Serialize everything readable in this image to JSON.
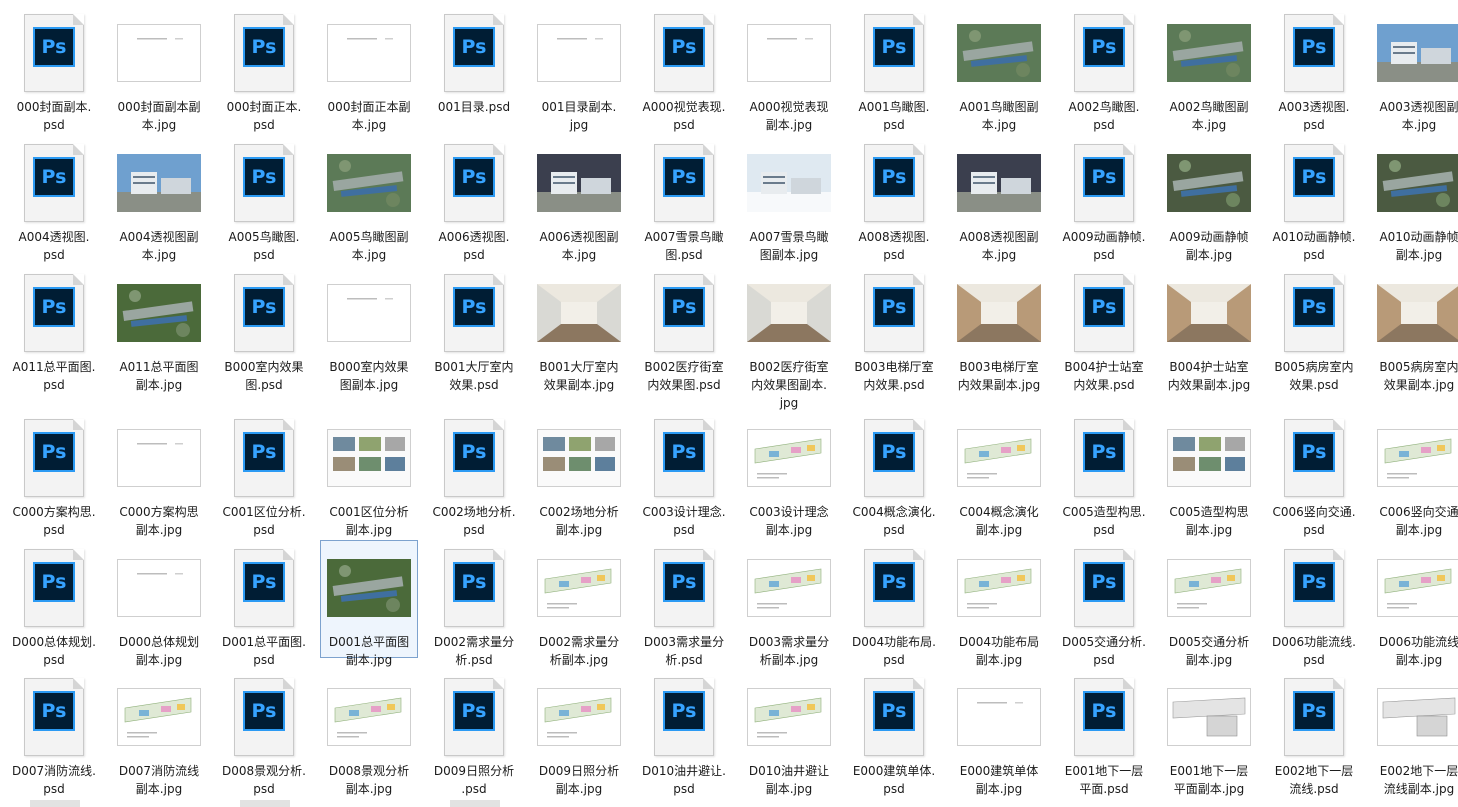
{
  "explorer": {
    "view": "large-icons",
    "selected_file": "D001总平面图副本.jpg",
    "files": [
      {
        "name": "000封面副本.psd",
        "line1": "000封面副本.",
        "line2": "psd",
        "kind": "psd"
      },
      {
        "name": "000封面副本副本.jpg",
        "line1": "000封面副本副",
        "line2": "本.jpg",
        "kind": "doc"
      },
      {
        "name": "000封面正本.psd",
        "line1": "000封面正本.",
        "line2": "psd",
        "kind": "psd"
      },
      {
        "name": "000封面正本副本.jpg",
        "line1": "000封面正本副",
        "line2": "本.jpg",
        "kind": "doc"
      },
      {
        "name": "001目录.psd",
        "line1": "001目录.psd",
        "line2": "",
        "kind": "psd"
      },
      {
        "name": "001目录副本.jpg",
        "line1": "001目录副本.",
        "line2": "jpg",
        "kind": "doc"
      },
      {
        "name": "A000视觉表现.psd",
        "line1": "A000视觉表现.",
        "line2": "psd",
        "kind": "psd"
      },
      {
        "name": "A000视觉表现副本.jpg",
        "line1": "A000视觉表现",
        "line2": "副本.jpg",
        "kind": "doc"
      },
      {
        "name": "A001鸟瞰图.psd",
        "line1": "A001鸟瞰图.",
        "line2": "psd",
        "kind": "psd"
      },
      {
        "name": "A001鸟瞰图副本.jpg",
        "line1": "A001鸟瞰图副",
        "line2": "本.jpg",
        "kind": "aerial"
      },
      {
        "name": "A002鸟瞰图.psd",
        "line1": "A002鸟瞰图.",
        "line2": "psd",
        "kind": "psd"
      },
      {
        "name": "A002鸟瞰图副本.jpg",
        "line1": "A002鸟瞰图副",
        "line2": "本.jpg",
        "kind": "aerial"
      },
      {
        "name": "A003透视图.psd",
        "line1": "A003透视图.",
        "line2": "psd",
        "kind": "psd"
      },
      {
        "name": "A003透视图副本.jpg",
        "line1": "A003透视图副",
        "line2": "本.jpg",
        "kind": "sky"
      },
      {
        "name": "A004透视图.psd",
        "line1": "A004透视图.",
        "line2": "psd",
        "kind": "psd"
      },
      {
        "name": "A004透视图副本.jpg",
        "line1": "A004透视图副",
        "line2": "本.jpg",
        "kind": "sky"
      },
      {
        "name": "A005鸟瞰图.psd",
        "line1": "A005鸟瞰图.",
        "line2": "psd",
        "kind": "psd"
      },
      {
        "name": "A005鸟瞰图副本.jpg",
        "line1": "A005鸟瞰图副",
        "line2": "本.jpg",
        "kind": "aerial"
      },
      {
        "name": "A006透视图.psd",
        "line1": "A006透视图.",
        "line2": "psd",
        "kind": "psd"
      },
      {
        "name": "A006透视图副本.jpg",
        "line1": "A006透视图副",
        "line2": "本.jpg",
        "kind": "dusk"
      },
      {
        "name": "A007雪景鸟瞰图.psd",
        "line1": "A007雪景鸟瞰",
        "line2": "图.psd",
        "kind": "psd"
      },
      {
        "name": "A007雪景鸟瞰图副本.jpg",
        "line1": "A007雪景鸟瞰",
        "line2": "图副本.jpg",
        "kind": "snow"
      },
      {
        "name": "A008透视图.psd",
        "line1": "A008透视图.",
        "line2": "psd",
        "kind": "psd"
      },
      {
        "name": "A008透视图副本.jpg",
        "line1": "A008透视图副",
        "line2": "本.jpg",
        "kind": "dusk"
      },
      {
        "name": "A009动画静帧.psd",
        "line1": "A009动画静帧.",
        "line2": "psd",
        "kind": "psd"
      },
      {
        "name": "A009动画静帧副本.jpg",
        "line1": "A009动画静帧",
        "line2": "副本.jpg",
        "kind": "collage"
      },
      {
        "name": "A010动画静帧.psd",
        "line1": "A010动画静帧.",
        "line2": "psd",
        "kind": "psd"
      },
      {
        "name": "A010动画静帧副本.jpg",
        "line1": "A010动画静帧",
        "line2": "副本.jpg",
        "kind": "collage"
      },
      {
        "name": "A011总平面图.psd",
        "line1": "A011总平面图.",
        "line2": "psd",
        "kind": "psd"
      },
      {
        "name": "A011总平面图副本.jpg",
        "line1": "A011总平面图",
        "line2": "副本.jpg",
        "kind": "plan"
      },
      {
        "name": "B000室内效果图.psd",
        "line1": "B000室内效果",
        "line2": "图.psd",
        "kind": "psd"
      },
      {
        "name": "B000室内效果图副本.jpg",
        "line1": "B000室内效果",
        "line2": "图副本.jpg",
        "kind": "doc"
      },
      {
        "name": "B001大厅室内效果.psd",
        "line1": "B001大厅室内",
        "line2": "效果.psd",
        "kind": "psd"
      },
      {
        "name": "B001大厅室内效果副本.jpg",
        "line1": "B001大厅室内",
        "line2": "效果副本.jpg",
        "kind": "interior"
      },
      {
        "name": "B002医疗街室内效果图.psd",
        "line1": "B002医疗街室",
        "line2": "内效果图.psd",
        "kind": "psd"
      },
      {
        "name": "B002医疗街室内效果图副本.jpg",
        "line1": "B002医疗街室",
        "line2": "内效果图副本.",
        "line3": "jpg",
        "kind": "interior"
      },
      {
        "name": "B003电梯厅室内效果.psd",
        "line1": "B003电梯厅室",
        "line2": "内效果.psd",
        "kind": "psd"
      },
      {
        "name": "B003电梯厅室内效果副本.jpg",
        "line1": "B003电梯厅室",
        "line2": "内效果副本.jpg",
        "kind": "warm"
      },
      {
        "name": "B004护士站室内效果.psd",
        "line1": "B004护士站室",
        "line2": "内效果.psd",
        "kind": "psd"
      },
      {
        "name": "B004护士站室内效果副本.jpg",
        "line1": "B004护士站室",
        "line2": "内效果副本.jpg",
        "kind": "warm"
      },
      {
        "name": "B005病房室内效果.psd",
        "line1": "B005病房室内",
        "line2": "效果.psd",
        "kind": "psd"
      },
      {
        "name": "B005病房室内效果副本.jpg",
        "line1": "B005病房室内",
        "line2": "效果副本.jpg",
        "kind": "warm"
      },
      {
        "name": "C000方案构思.psd",
        "line1": "C000方案构思.",
        "line2": "psd",
        "kind": "psd"
      },
      {
        "name": "C000方案构思副本.jpg",
        "line1": "C000方案构思",
        "line2": "副本.jpg",
        "kind": "doc"
      },
      {
        "name": "C001区位分析.psd",
        "line1": "C001区位分析.",
        "line2": "psd",
        "kind": "psd"
      },
      {
        "name": "C001区位分析副本.jpg",
        "line1": "C001区位分析",
        "line2": "副本.jpg",
        "kind": "board"
      },
      {
        "name": "C002场地分析.psd",
        "line1": "C002场地分析.",
        "line2": "psd",
        "kind": "psd"
      },
      {
        "name": "C002场地分析副本.jpg",
        "line1": "C002场地分析",
        "line2": "副本.jpg",
        "kind": "board"
      },
      {
        "name": "C003设计理念.psd",
        "line1": "C003设计理念.",
        "line2": "psd",
        "kind": "psd"
      },
      {
        "name": "C003设计理念副本.jpg",
        "line1": "C003设计理念",
        "line2": "副本.jpg",
        "kind": "diagram"
      },
      {
        "name": "C004概念演化.psd",
        "line1": "C004概念演化.",
        "line2": "psd",
        "kind": "psd"
      },
      {
        "name": "C004概念演化副本.jpg",
        "line1": "C004概念演化",
        "line2": "副本.jpg",
        "kind": "diagram"
      },
      {
        "name": "C005造型构思.psd",
        "line1": "C005造型构思.",
        "line2": "psd",
        "kind": "psd"
      },
      {
        "name": "C005造型构思副本.jpg",
        "line1": "C005造型构思",
        "line2": "副本.jpg",
        "kind": "board"
      },
      {
        "name": "C006竖向交通.psd",
        "line1": "C006竖向交通.",
        "line2": "psd",
        "kind": "psd"
      },
      {
        "name": "C006竖向交通副本.jpg",
        "line1": "C006竖向交通",
        "line2": "副本.jpg",
        "kind": "diagram"
      },
      {
        "name": "D000总体规划.psd",
        "line1": "D000总体规划.",
        "line2": "psd",
        "kind": "psd"
      },
      {
        "name": "D000总体规划副本.jpg",
        "line1": "D000总体规划",
        "line2": "副本.jpg",
        "kind": "doc"
      },
      {
        "name": "D001总平面图.psd",
        "line1": "D001总平面图.",
        "line2": "psd",
        "kind": "psd"
      },
      {
        "name": "D001总平面图副本.jpg",
        "line1": "D001总平面图",
        "line2": "副本.jpg",
        "kind": "plan"
      },
      {
        "name": "D002需求量分析.psd",
        "line1": "D002需求量分",
        "line2": "析.psd",
        "kind": "psd"
      },
      {
        "name": "D002需求量分析副本.jpg",
        "line1": "D002需求量分",
        "line2": "析副本.jpg",
        "kind": "diagram"
      },
      {
        "name": "D003需求量分析.psd",
        "line1": "D003需求量分",
        "line2": "析.psd",
        "kind": "psd"
      },
      {
        "name": "D003需求量分析副本.jpg",
        "line1": "D003需求量分",
        "line2": "析副本.jpg",
        "kind": "diagram"
      },
      {
        "name": "D004功能布局.psd",
        "line1": "D004功能布局.",
        "line2": "psd",
        "kind": "psd"
      },
      {
        "name": "D004功能布局副本.jpg",
        "line1": "D004功能布局",
        "line2": "副本.jpg",
        "kind": "diagram"
      },
      {
        "name": "D005交通分析.psd",
        "line1": "D005交通分析.",
        "line2": "psd",
        "kind": "psd"
      },
      {
        "name": "D005交通分析副本.jpg",
        "line1": "D005交通分析",
        "line2": "副本.jpg",
        "kind": "diagram"
      },
      {
        "name": "D006功能流线.psd",
        "line1": "D006功能流线.",
        "line2": "psd",
        "kind": "psd"
      },
      {
        "name": "D006功能流线副本.jpg",
        "line1": "D006功能流线",
        "line2": "副本.jpg",
        "kind": "diagram"
      },
      {
        "name": "D007消防流线.psd",
        "line1": "D007消防流线.",
        "line2": "psd",
        "kind": "psd"
      },
      {
        "name": "D007消防流线副本.jpg",
        "line1": "D007消防流线",
        "line2": "副本.jpg",
        "kind": "diagram"
      },
      {
        "name": "D008景观分析.psd",
        "line1": "D008景观分析.",
        "line2": "psd",
        "kind": "psd"
      },
      {
        "name": "D008景观分析副本.jpg",
        "line1": "D008景观分析",
        "line2": "副本.jpg",
        "kind": "diagram"
      },
      {
        "name": "D009日照分析.psd",
        "line1": "D009日照分析",
        "line2": ".psd",
        "kind": "psd"
      },
      {
        "name": "D009日照分析副本.jpg",
        "line1": "D009日照分析",
        "line2": "副本.jpg",
        "kind": "diagram"
      },
      {
        "name": "D010油井避让.psd",
        "line1": "D010油井避让.",
        "line2": "psd",
        "kind": "psd"
      },
      {
        "name": "D010油井避让副本.jpg",
        "line1": "D010油井避让",
        "line2": "副本.jpg",
        "kind": "diagram"
      },
      {
        "name": "E000建筑单体.psd",
        "line1": "E000建筑单体.",
        "line2": "psd",
        "kind": "psd"
      },
      {
        "name": "E000建筑单体副本.jpg",
        "line1": "E000建筑单体",
        "line2": "副本.jpg",
        "kind": "doc"
      },
      {
        "name": "E001地下一层平面.psd",
        "line1": "E001地下一层",
        "line2": "平面.psd",
        "kind": "psd"
      },
      {
        "name": "E001地下一层平面副本.jpg",
        "line1": "E001地下一层",
        "line2": "平面副本.jpg",
        "kind": "floorplan"
      },
      {
        "name": "E002地下一层流线.psd",
        "line1": "E002地下一层",
        "line2": "流线.psd",
        "kind": "psd"
      },
      {
        "name": "E002地下一层流线副本.jpg",
        "line1": "E002地下一层",
        "line2": "流线副本.jpg",
        "kind": "floorplan"
      }
    ],
    "ps_label": "Ps",
    "thumb_colors": {
      "doc": "#ffffff",
      "aerial": "#5c7a57",
      "sky": "#6fa0cf",
      "dusk": "#3b3f4e",
      "snow": "#dfe9f1",
      "collage": "#4b5a41",
      "plan": "#4b6a3a",
      "interior": "#d9d9d4",
      "warm": "#b89a78",
      "board": "#e9e9e9",
      "diagram": "#f7f7f7",
      "floorplan": "#f0f0f0"
    }
  }
}
